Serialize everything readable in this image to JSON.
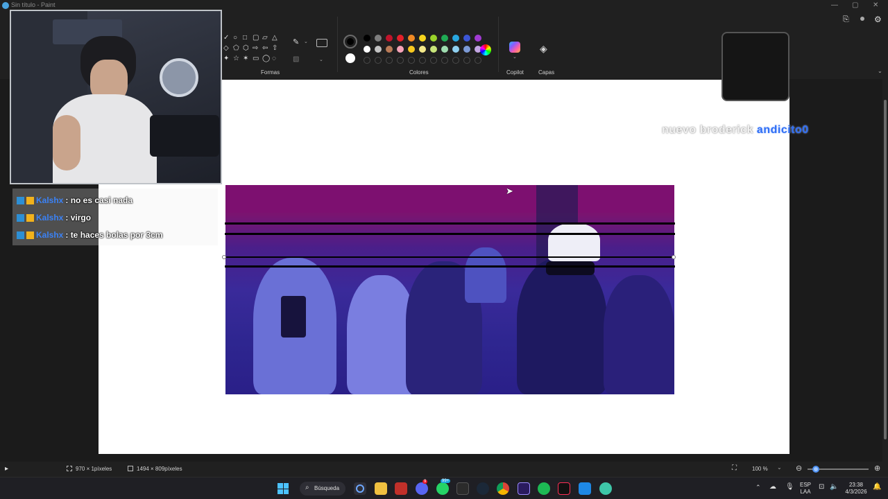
{
  "window": {
    "title": "Sin título - Paint",
    "controls": {
      "minimize": "—",
      "maximize": "▢",
      "close": "✕"
    }
  },
  "ribbon": {
    "groups": {
      "shapes_label": "Formas",
      "colors_label": "Colores",
      "copilot_label": "Copilot",
      "layers_label": "Capas"
    },
    "shape_glyphs": [
      "✓",
      "○",
      "□",
      "▢",
      "▱",
      "△",
      "◇",
      "⬠",
      "⬡",
      "⇨",
      "⇦",
      "⇧",
      "✦",
      "☆",
      "✶",
      "▭",
      "◯",
      "◌"
    ],
    "palette_row1": [
      "#000000",
      "#7f7f7f",
      "#c0142b",
      "#e3202a",
      "#f08a24",
      "#f7d51d",
      "#9ad32a",
      "#1faa54",
      "#28a7e0",
      "#3c56d6",
      "#a13bd3"
    ],
    "palette_row2": [
      "#ffffff",
      "#c3c3c3",
      "#b97a57",
      "#f5a3b8",
      "#f7c81f",
      "#f3e88a",
      "#c8e57a",
      "#9fdcb0",
      "#8fd0f0",
      "#7c9ad6",
      "#c3a6e4"
    ],
    "primary_color": "#000000",
    "secondary_color": "#ffffff"
  },
  "chat": {
    "messages": [
      {
        "user": "Kalshx",
        "text": ": no es casi nada"
      },
      {
        "user": "Kalshx",
        "text": ": virgo"
      },
      {
        "user": "Kalshx",
        "text": ": te haces bolas por 3cm"
      }
    ],
    "user_color": "#3b82f6"
  },
  "overlay": {
    "text_white": "nuevo broderick ",
    "text_blue": "andicito0"
  },
  "statusbar": {
    "selection_size": "970 × 1píxeles",
    "canvas_size": "1494 × 809píxeles",
    "zoom": "100 %"
  },
  "taskbar": {
    "search_label": "Búsqueda",
    "language_top": "ESP",
    "language_bottom": "LAA",
    "time": "23:38",
    "date": "4/3/2026",
    "discord_badge": "9",
    "whatsapp_badge": "99+"
  }
}
